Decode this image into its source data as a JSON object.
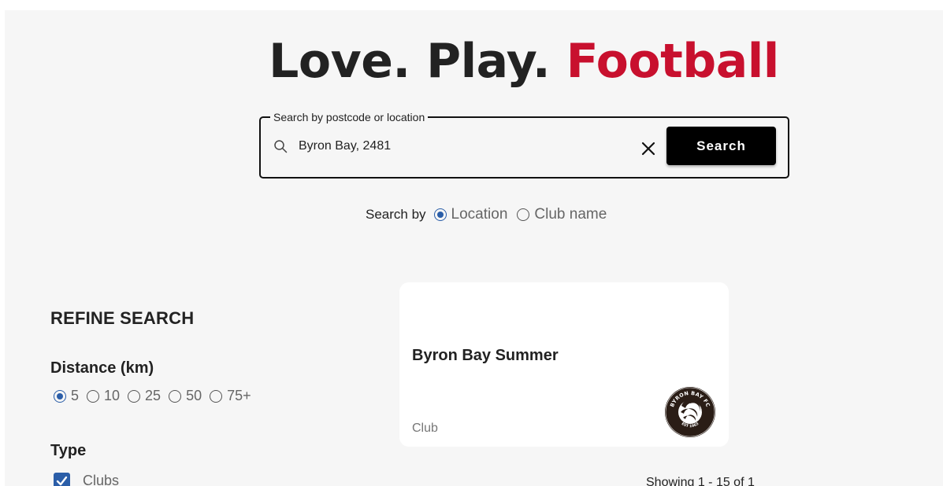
{
  "hero": {
    "title_main": "Love. Play.",
    "title_accent": "Football",
    "accent_color": "#c8102e"
  },
  "search": {
    "legend": "Search by postcode or location",
    "value": "Byron Bay, 2481",
    "button_label": "Search",
    "search_by_label": "Search by",
    "options": [
      {
        "label": "Location",
        "checked": true
      },
      {
        "label": "Club name",
        "checked": false
      }
    ]
  },
  "refine": {
    "title": "REFINE SEARCH",
    "distance_label": "Distance (km)",
    "distance_options": [
      {
        "label": "5",
        "checked": true
      },
      {
        "label": "10",
        "checked": false
      },
      {
        "label": "25",
        "checked": false
      },
      {
        "label": "50",
        "checked": false
      },
      {
        "label": "75+",
        "checked": false
      }
    ],
    "type_label": "Type",
    "type_options": [
      {
        "label": "Clubs",
        "checked": true
      }
    ]
  },
  "results": {
    "cards": [
      {
        "title": "Byron Bay Summer",
        "type": "Club",
        "logo_text": "BYRON BAY FC",
        "logo_year": "EST 1963"
      }
    ],
    "showing_text": "Showing 1 - 15 of 1"
  },
  "colors": {
    "primary": "#2b5ea8",
    "accent": "#c8102e"
  },
  "icons": {
    "search": "search-icon",
    "clear": "close-icon",
    "check": "check-icon"
  }
}
